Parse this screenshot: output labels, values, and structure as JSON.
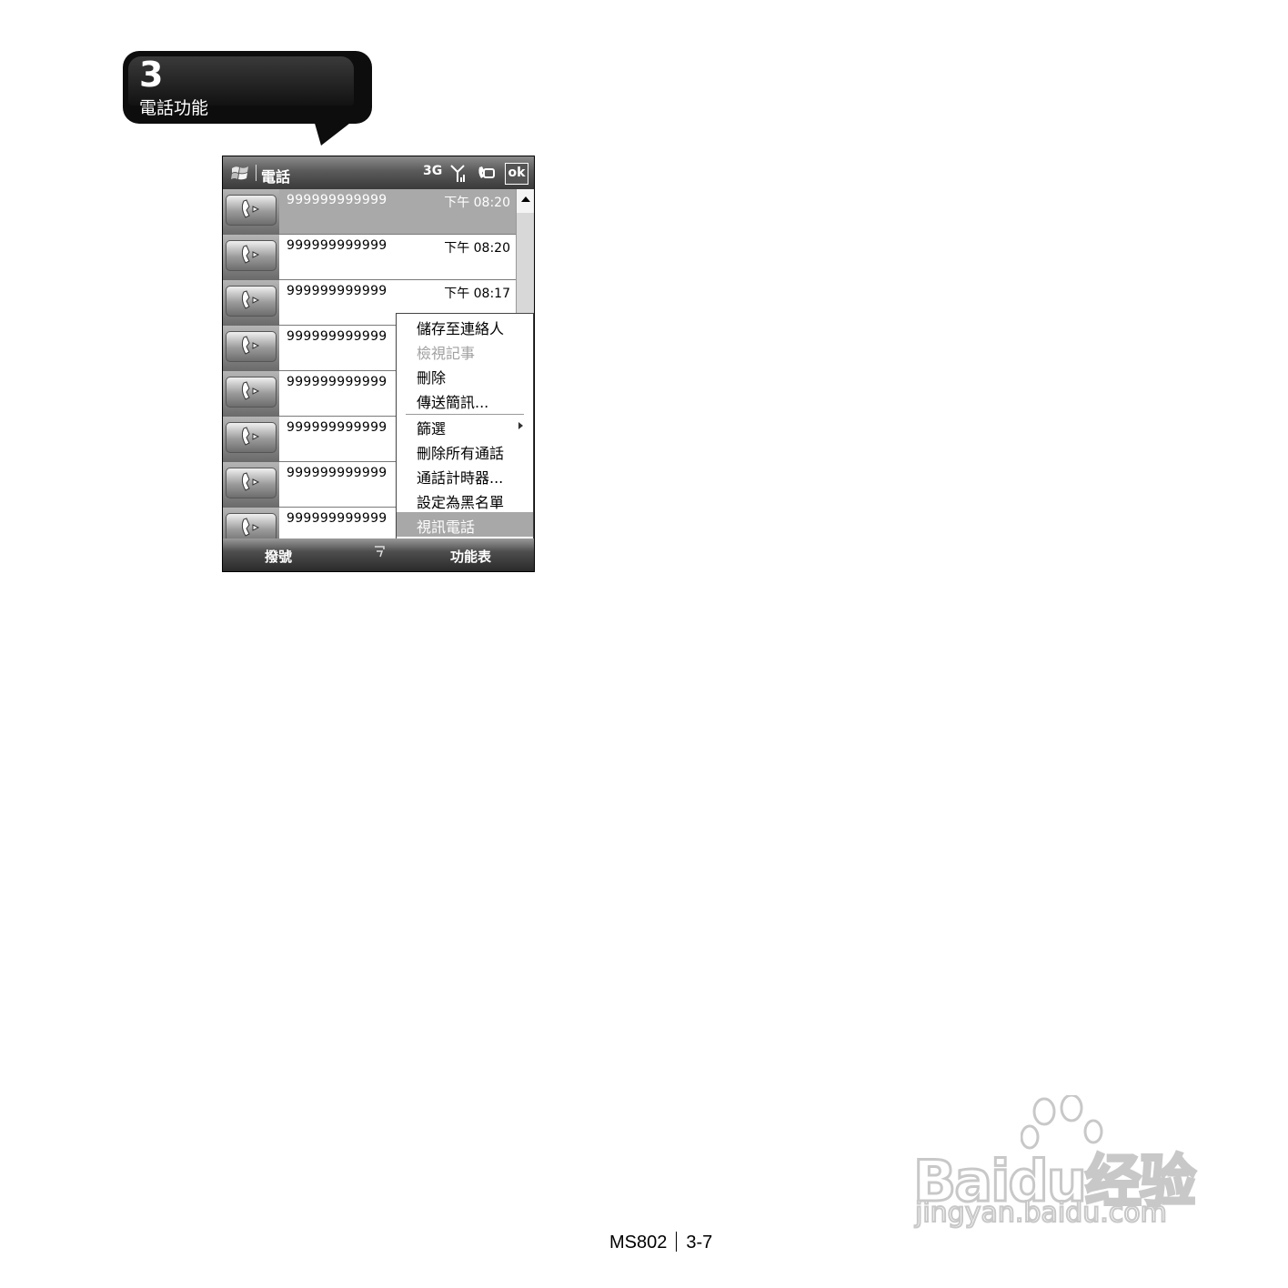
{
  "chapter": {
    "number": "3",
    "title": "電話功能"
  },
  "phone": {
    "titlebar": {
      "title": "電話",
      "status_3g": "3G",
      "ok_label": "ok"
    },
    "calls": [
      {
        "number": "999999999999",
        "time": "下午 08:20",
        "selected": true
      },
      {
        "number": "999999999999",
        "time": "下午 08:20"
      },
      {
        "number": "999999999999",
        "time": "下午 08:17"
      },
      {
        "number": "999999999999"
      },
      {
        "number": "999999999999"
      },
      {
        "number": "999999999999"
      },
      {
        "number": "999999999999"
      },
      {
        "number": "999999999999"
      }
    ],
    "menu": {
      "items": [
        {
          "label": "儲存至連絡人"
        },
        {
          "label": "檢視記事",
          "disabled": true
        },
        {
          "label": "刪除"
        },
        {
          "label": "傳送簡訊..."
        },
        {
          "label": "篩選",
          "submenu": true
        },
        {
          "label": "刪除所有通話"
        },
        {
          "label": "通話計時器..."
        },
        {
          "label": "設定為黑名單"
        },
        {
          "label": "視訊電話",
          "highlighted": true
        }
      ]
    },
    "softkeys": {
      "left": "撥號",
      "right": "功能表"
    }
  },
  "footer": {
    "model": "MS802",
    "page": "3-7"
  },
  "watermark": {
    "brand": "Baidu经验",
    "url": "jingyan.baidu.com"
  },
  "colors": {
    "selection": "#a9a9a9",
    "bar_dark": "#2a2a2a"
  }
}
